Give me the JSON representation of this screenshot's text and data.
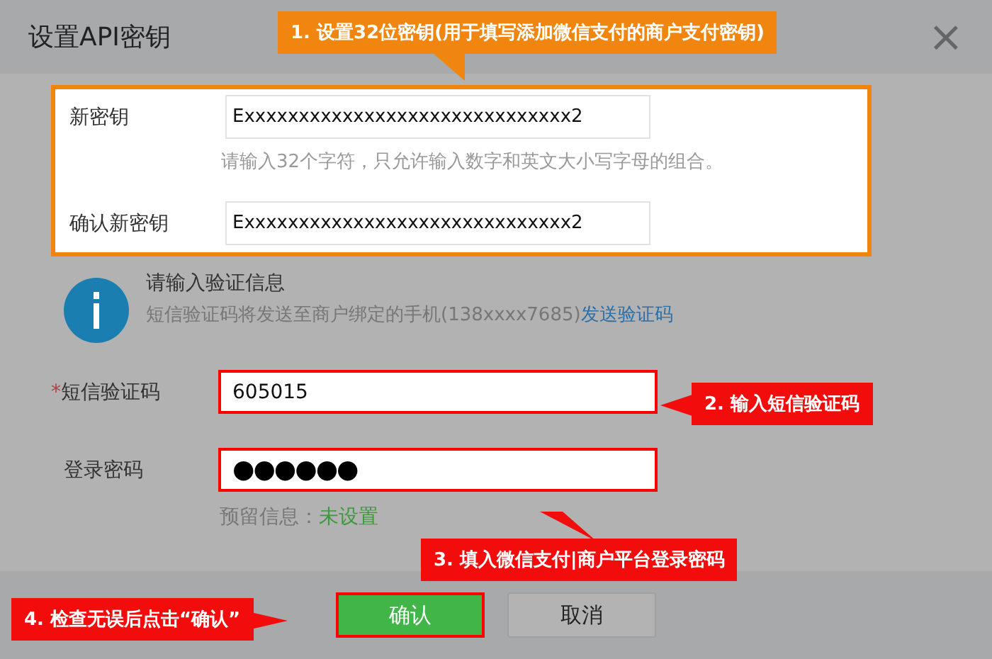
{
  "dialog": {
    "title": "设置API密钥",
    "close": "×"
  },
  "key_section": {
    "fields": [
      {
        "label": "新密钥",
        "value": "Exxxxxxxxxxxxxxxxxxxxxxxxxxxxxx2"
      },
      {
        "label": "确认新密钥",
        "value": "Exxxxxxxxxxxxxxxxxxxxxxxxxxxxxx2"
      }
    ],
    "hint": "请输入32个字符，只允许输入数字和英文大小写字母的组合。"
  },
  "verify_notice": {
    "title": "请输入验证信息",
    "text": "短信验证码将发送至商户绑定的手机(138xxxx7685)",
    "link": "发送验证码"
  },
  "sms_field": {
    "label": "短信验证码",
    "required_mark": "*",
    "value": "605015"
  },
  "password_field": {
    "label": "登录密码",
    "value": "●●●●●●"
  },
  "reserved": {
    "label": "预留信息：",
    "value": "未设置"
  },
  "buttons": [
    {
      "label": "确认",
      "kind": "primary"
    },
    {
      "label": "取消",
      "kind": "secondary"
    }
  ],
  "callouts": [
    {
      "text": "1. 设置32位密钥(用于填写添加微信支付的商户支付密钥)",
      "color": "#f0860f"
    },
    {
      "text": "2. 输入短信验证码",
      "color": "#f20c0c"
    },
    {
      "text": "3. 填入微信支付|商户平台登录密码",
      "color": "#f20c0c"
    },
    {
      "text": "4. 检查无误后点击“确认”",
      "color": "#f20c0c"
    }
  ]
}
